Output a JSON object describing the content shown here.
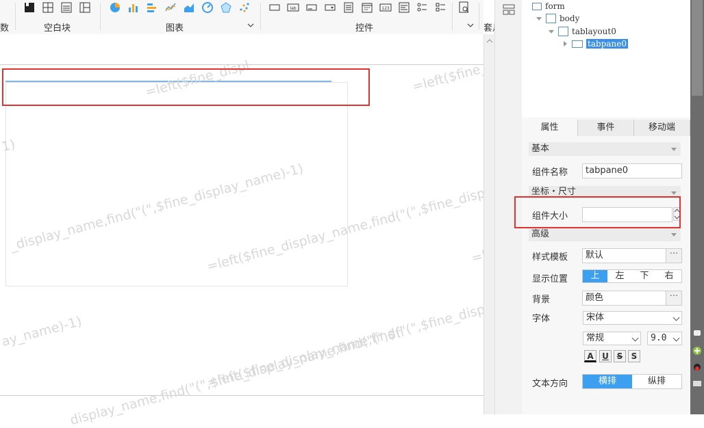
{
  "toolbar": {
    "groups": [
      {
        "label": "数"
      },
      {
        "label": "空白块"
      },
      {
        "label": "图表"
      },
      {
        "label": "控件"
      },
      {
        "label": "套月"
      }
    ]
  },
  "canvas": {
    "watermarks": [
      "=left($fine_displ",
      "=left($fine_di",
      "1)",
      "_display_name,find(\"(\",$fine_display_name)-1)",
      "display_name,find(\"(\",$fine_display_name)-1)",
      "=left($fine_display_name,find(\"(\",$fine_displa",
      "ay_name)-1)",
      "=left($fine_display_name,find(\"(\",$fine_display_name)-1)",
      "display_name,find(\"(\",$fine_display_name,find(\"(\",$fi",
      "=l"
    ]
  },
  "tree": {
    "items": [
      {
        "label": "form"
      },
      {
        "label": "body"
      },
      {
        "label": "tablayout0"
      },
      {
        "label": "tabpane0"
      }
    ]
  },
  "panel": {
    "tabs": [
      "属性",
      "事件",
      "移动端"
    ],
    "sections": {
      "basic": "基本",
      "coords": "坐标・尺寸",
      "advanced": "高级"
    },
    "fields": {
      "name_label": "组件名称",
      "name_value": "tabpane0",
      "size_label": "组件大小",
      "size_value": "",
      "style_label": "样式模板",
      "style_value": "默认",
      "position_label": "显示位置",
      "position_options": [
        "上",
        "左",
        "下",
        "右"
      ],
      "position_selected": "上",
      "background_label": "背景",
      "background_value": "颜色",
      "font_label": "字体",
      "font_value": "宋体",
      "font_style": "常规",
      "font_size": "9.0",
      "text_dir_label": "文本方向",
      "text_dir_options": [
        "横排",
        "纵排"
      ],
      "text_dir_selected": "横排"
    },
    "dots": "···",
    "format_buttons": [
      "A",
      "U",
      "S",
      "S"
    ]
  },
  "colors": {
    "accent": "#3c9ff0",
    "highlight_box": "#e53030",
    "selected_tree": "#3c8fe6"
  }
}
